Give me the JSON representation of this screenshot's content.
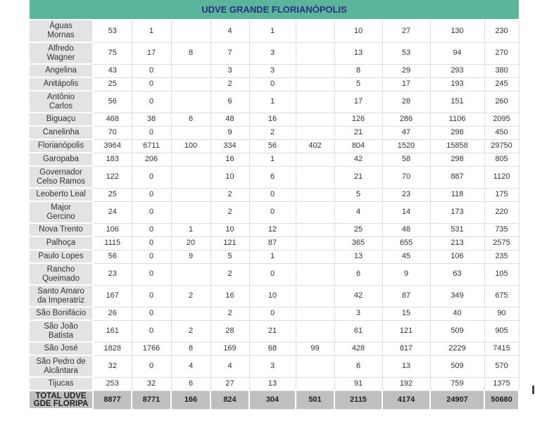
{
  "title": "UDVE GRANDE FLORIANÓPOLIS",
  "rows": [
    {
      "name": "Águas Mornas",
      "lines": [
        "Águas",
        "Mornas"
      ],
      "vals": [
        "53",
        "1",
        "",
        "4",
        "1",
        "",
        "10",
        "27",
        "130",
        "230"
      ]
    },
    {
      "name": "Alfredo Wagner",
      "lines": [
        "Alfredo",
        "Wagner"
      ],
      "vals": [
        "75",
        "17",
        "8",
        "7",
        "3",
        "",
        "13",
        "53",
        "94",
        "270"
      ]
    },
    {
      "name": "Angelina",
      "lines": [
        "Angelina"
      ],
      "vals": [
        "43",
        "0",
        "",
        "3",
        "3",
        "",
        "8",
        "29",
        "293",
        "380"
      ]
    },
    {
      "name": "Anitápolis",
      "lines": [
        "Anitápolis"
      ],
      "vals": [
        "25",
        "0",
        "",
        "2",
        "0",
        "",
        "5",
        "17",
        "193",
        "245"
      ]
    },
    {
      "name": "Antônio Carlos",
      "lines": [
        "Antônio",
        "Carlos"
      ],
      "vals": [
        "56",
        "0",
        "",
        "6",
        "1",
        "",
        "17",
        "28",
        "151",
        "260"
      ]
    },
    {
      "name": "Biguaçu",
      "lines": [
        "Biguaçu"
      ],
      "vals": [
        "468",
        "38",
        "6",
        "48",
        "16",
        "",
        "126",
        "286",
        "1106",
        "2095"
      ]
    },
    {
      "name": "Canelinha",
      "lines": [
        "Canelinha"
      ],
      "vals": [
        "70",
        "0",
        "",
        "9",
        "2",
        "",
        "21",
        "47",
        "298",
        "450"
      ]
    },
    {
      "name": "Florianópolis",
      "lines": [
        "Florianópolis"
      ],
      "vals": [
        "3964",
        "6711",
        "100",
        "334",
        "56",
        "402",
        "804",
        "1520",
        "15858",
        "29750"
      ]
    },
    {
      "name": "Garopaba",
      "lines": [
        "Garopaba"
      ],
      "vals": [
        "183",
        "206",
        "",
        "16",
        "1",
        "",
        "42",
        "58",
        "298",
        "805"
      ]
    },
    {
      "name": "Governador Celso Ramos",
      "lines": [
        "Governador",
        "Celso Ramos"
      ],
      "vals": [
        "122",
        "0",
        "",
        "10",
        "6",
        "",
        "21",
        "70",
        "887",
        "1120"
      ]
    },
    {
      "name": "Leoberto Leal",
      "lines": [
        "Leoberto Leal"
      ],
      "vals": [
        "25",
        "0",
        "",
        "2",
        "0",
        "",
        "5",
        "23",
        "118",
        "175"
      ]
    },
    {
      "name": "Major Gercino",
      "lines": [
        "Major",
        "Gercino"
      ],
      "vals": [
        "24",
        "0",
        "",
        "2",
        "0",
        "",
        "4",
        "14",
        "173",
        "220"
      ]
    },
    {
      "name": "Nova Trento",
      "lines": [
        "Nova Trento"
      ],
      "vals": [
        "106",
        "0",
        "1",
        "10",
        "12",
        "",
        "25",
        "48",
        "531",
        "735"
      ]
    },
    {
      "name": "Palhoça",
      "lines": [
        "Palhoça"
      ],
      "vals": [
        "1115",
        "0",
        "20",
        "121",
        "87",
        "",
        "365",
        "655",
        "213",
        "2575"
      ]
    },
    {
      "name": "Paulo Lopes",
      "lines": [
        "Paulo Lopes"
      ],
      "vals": [
        "56",
        "0",
        "9",
        "5",
        "1",
        "",
        "13",
        "45",
        "106",
        "235"
      ]
    },
    {
      "name": "Rancho Queimado",
      "lines": [
        "Rancho",
        "Queimado"
      ],
      "vals": [
        "23",
        "0",
        "",
        "2",
        "0",
        "",
        "6",
        "9",
        "63",
        "105"
      ]
    },
    {
      "name": "Santo Amaro da Imperatriz",
      "lines": [
        "Santo Amaro",
        "da Imperatriz"
      ],
      "vals": [
        "167",
        "0",
        "2",
        "16",
        "10",
        "",
        "42",
        "87",
        "349",
        "675"
      ]
    },
    {
      "name": "São Bonifácio",
      "lines": [
        "São Bonifácio"
      ],
      "vals": [
        "26",
        "0",
        "",
        "2",
        "0",
        "",
        "3",
        "15",
        "40",
        "90"
      ]
    },
    {
      "name": "São João Batista",
      "lines": [
        "São João",
        "Batista"
      ],
      "vals": [
        "161",
        "0",
        "2",
        "28",
        "21",
        "",
        "61",
        "121",
        "509",
        "905"
      ]
    },
    {
      "name": "São José",
      "lines": [
        "São José"
      ],
      "vals": [
        "1828",
        "1766",
        "8",
        "169",
        "68",
        "99",
        "428",
        "817",
        "2229",
        "7415"
      ]
    },
    {
      "name": "São Pedro de Alcântara",
      "lines": [
        "São Pedro de",
        "Alcântara"
      ],
      "vals": [
        "32",
        "0",
        "4",
        "4",
        "3",
        "",
        "6",
        "13",
        "509",
        "570"
      ]
    },
    {
      "name": "Tijucas",
      "lines": [
        "Tijucas"
      ],
      "vals": [
        "253",
        "32",
        "6",
        "27",
        "13",
        "",
        "91",
        "192",
        "759",
        "1375"
      ]
    }
  ],
  "total": {
    "lines": [
      "TOTAL UDVE",
      "GDE FLORIPA"
    ],
    "vals": [
      "8877",
      "8771",
      "166",
      "824",
      "304",
      "501",
      "2115",
      "4174",
      "24907",
      "50680"
    ]
  }
}
